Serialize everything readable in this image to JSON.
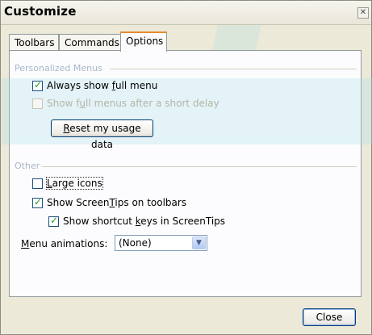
{
  "window": {
    "title": "Customize",
    "close_glyph": "✕"
  },
  "tabs": [
    {
      "label": "Toolbars",
      "active": false
    },
    {
      "label": "Commands",
      "active": false
    },
    {
      "label": "Options",
      "active": true
    }
  ],
  "personalized": {
    "group_label": "Personalized Menus",
    "always_full": {
      "pre": "Always show ",
      "u": "f",
      "post": "ull menu",
      "checked": true,
      "enabled": true
    },
    "full_after_delay": {
      "pre": "Show f",
      "u": "u",
      "post": "ll menus after a short delay",
      "checked": false,
      "enabled": false
    },
    "reset_button": {
      "u": "R",
      "post": "eset my usage data"
    }
  },
  "other": {
    "group_label": "Other",
    "large_icons": {
      "u": "L",
      "post": "arge icons",
      "checked": false
    },
    "screentips": {
      "pre": "Show Screen",
      "u": "T",
      "post": "ips on toolbars",
      "checked": true
    },
    "shortcut_keys": {
      "pre": "Show shortcut ",
      "u": "k",
      "post": "eys in ScreenTips",
      "checked": true
    },
    "menu_animations": {
      "u": "M",
      "post": "enu animations:",
      "selected": "(None)"
    }
  },
  "footer": {
    "close_label": "Close"
  },
  "colors": {
    "dialog_bg": "#ece9d8",
    "panel_bg": "#fcfcfe",
    "tab_highlight": "#e68b2c",
    "button_border": "#003c74",
    "check_mark": "#21a121",
    "disabled_text": "#b6b4a5"
  }
}
